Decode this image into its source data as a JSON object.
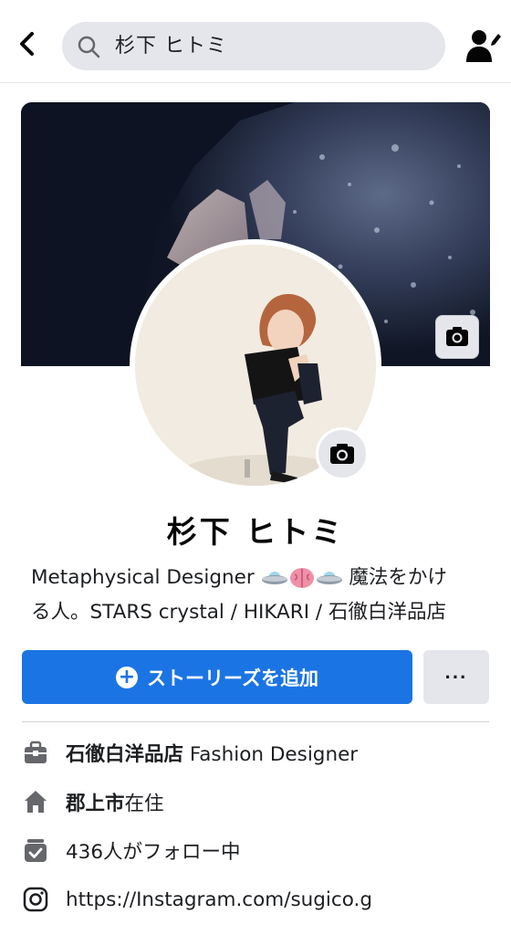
{
  "header": {
    "search_query": "杉下 ヒトミ",
    "back_icon": "chevron-left-icon",
    "search_icon": "search-icon",
    "profile_action_icon": "user-edit-icon"
  },
  "cover": {
    "camera_icon": "camera-icon"
  },
  "avatar": {
    "camera_icon": "camera-icon"
  },
  "profile": {
    "name": "杉下 ヒトミ",
    "bio_line1_text": "Metaphysical Designer",
    "bio_line1_tail": "魔法をかけ",
    "bio_line2": "る人。STARS crystal / HIKARI / 石徹白洋品店",
    "bio_emojis": [
      "ufo-emoji",
      "brain-emoji",
      "ufo-emoji"
    ]
  },
  "actions": {
    "add_story_label": "ストーリーズを追加",
    "more_label": "···"
  },
  "info": {
    "work_org": "石徹白洋品店",
    "work_role": " Fashion Designer",
    "home_city": "郡上市",
    "home_suffix": "在住",
    "following": "436人がフォロー中",
    "instagram": "https://Instagram.com/sugico.g"
  },
  "colors": {
    "primary": "#1b74e4",
    "secondary_bg": "#e4e6eb",
    "text": "#1c1e21",
    "icon": "#65676b"
  }
}
